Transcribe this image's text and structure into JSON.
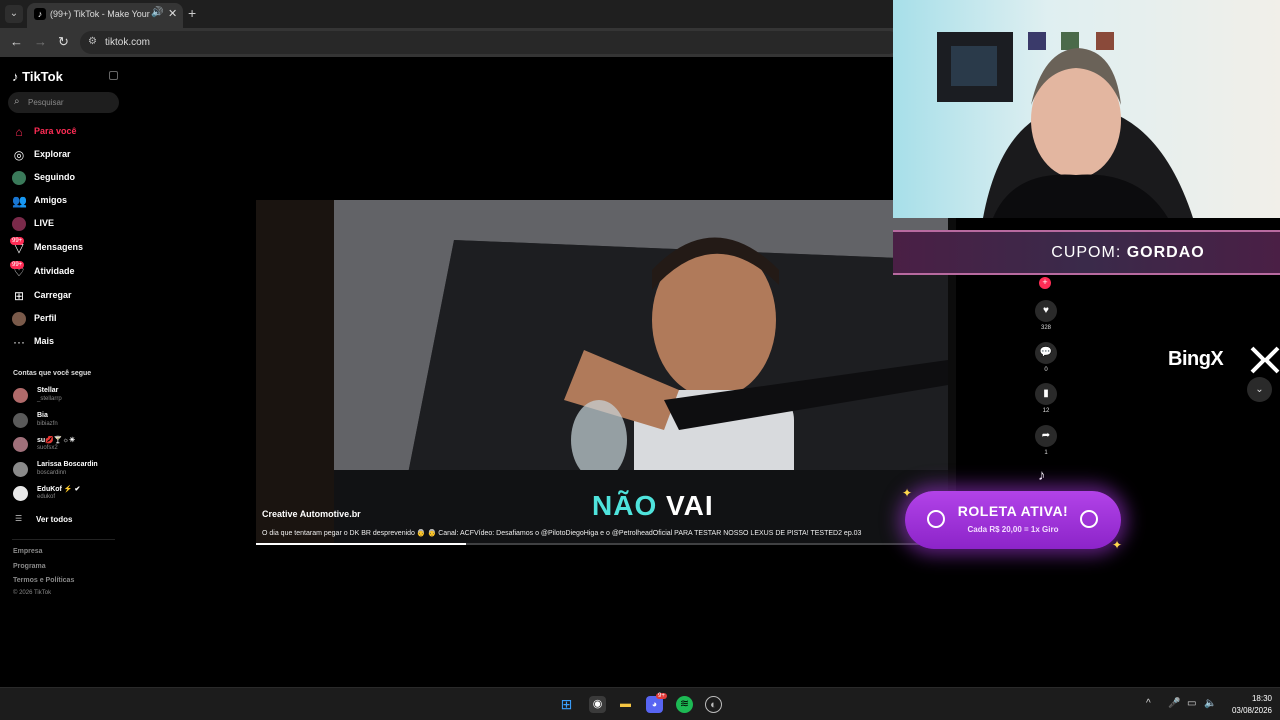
{
  "browser": {
    "tab_title": "(99+) TikTok - Make Your Day",
    "url": "tiktok.com"
  },
  "tiktok": {
    "logo": "TikTok",
    "search_placeholder": "Pesquisar",
    "nav": [
      {
        "label": "Para você",
        "icon": "home-icon",
        "active": true
      },
      {
        "label": "Explorar",
        "icon": "compass-icon"
      },
      {
        "label": "Seguindo",
        "icon": "following-icon"
      },
      {
        "label": "Amigos",
        "icon": "friends-icon"
      },
      {
        "label": "LIVE",
        "icon": "live-icon"
      },
      {
        "label": "Mensagens",
        "icon": "messages-icon",
        "badge": "99+"
      },
      {
        "label": "Atividade",
        "icon": "activity-icon",
        "badge": "99+"
      },
      {
        "label": "Carregar",
        "icon": "upload-icon"
      },
      {
        "label": "Perfil",
        "icon": "profile-icon"
      },
      {
        "label": "Mais",
        "icon": "more-icon"
      }
    ],
    "following_title": "Contas que você segue",
    "following": [
      {
        "name": "Stellar",
        "handle": "_stellarrp"
      },
      {
        "name": "Bia",
        "handle": "bibiazfn"
      },
      {
        "name": "su💋🍸☼☀",
        "handle": "suofsx2"
      },
      {
        "name": "Larissa Boscardin",
        "handle": "boscardinn"
      },
      {
        "name": "EduKof ⚡ ✔",
        "handle": "edukof"
      }
    ],
    "see_all": "Ver todos",
    "footer": [
      "Empresa",
      "Programa",
      "Termos e Políticas"
    ],
    "copyright": "© 2026 TikTok"
  },
  "video": {
    "subtitle_a": "NÃO",
    "subtitle_b": "VAI",
    "author": "Creative Automotive.br",
    "description": "O dia que tentaram pegar o DK BR desprevenido 👵 👵 Canal: ACFVídeo: Desafiamos o @PilotoDiegoHiga e o @PetrolheadOficial PARA TESTAR NOSSO LEXUS DE PISTA! TESTED2 ep.03",
    "progress": 0.3
  },
  "actions": [
    {
      "icon": "heart-icon",
      "count": "328"
    },
    {
      "icon": "comment-icon",
      "count": "0"
    },
    {
      "icon": "bookmark-icon",
      "count": "12"
    },
    {
      "icon": "share-icon",
      "count": "1"
    }
  ],
  "overlay": {
    "coupon_label": "CUPOM:",
    "coupon_code": "GORDAO",
    "sponsor": "BingX",
    "roulette_title": "ROLETA ATIVA!",
    "roulette_sub": "Cada R$ 20,00 = 1x Giro"
  },
  "taskbar": {
    "time": "18:30",
    "date": "03/08/2026",
    "discord_badge": "9+"
  },
  "colors": {
    "tiktok_red": "#fe2c55",
    "roulette_purple": "#a43ae0",
    "coupon_bg": "#4a1f45"
  }
}
